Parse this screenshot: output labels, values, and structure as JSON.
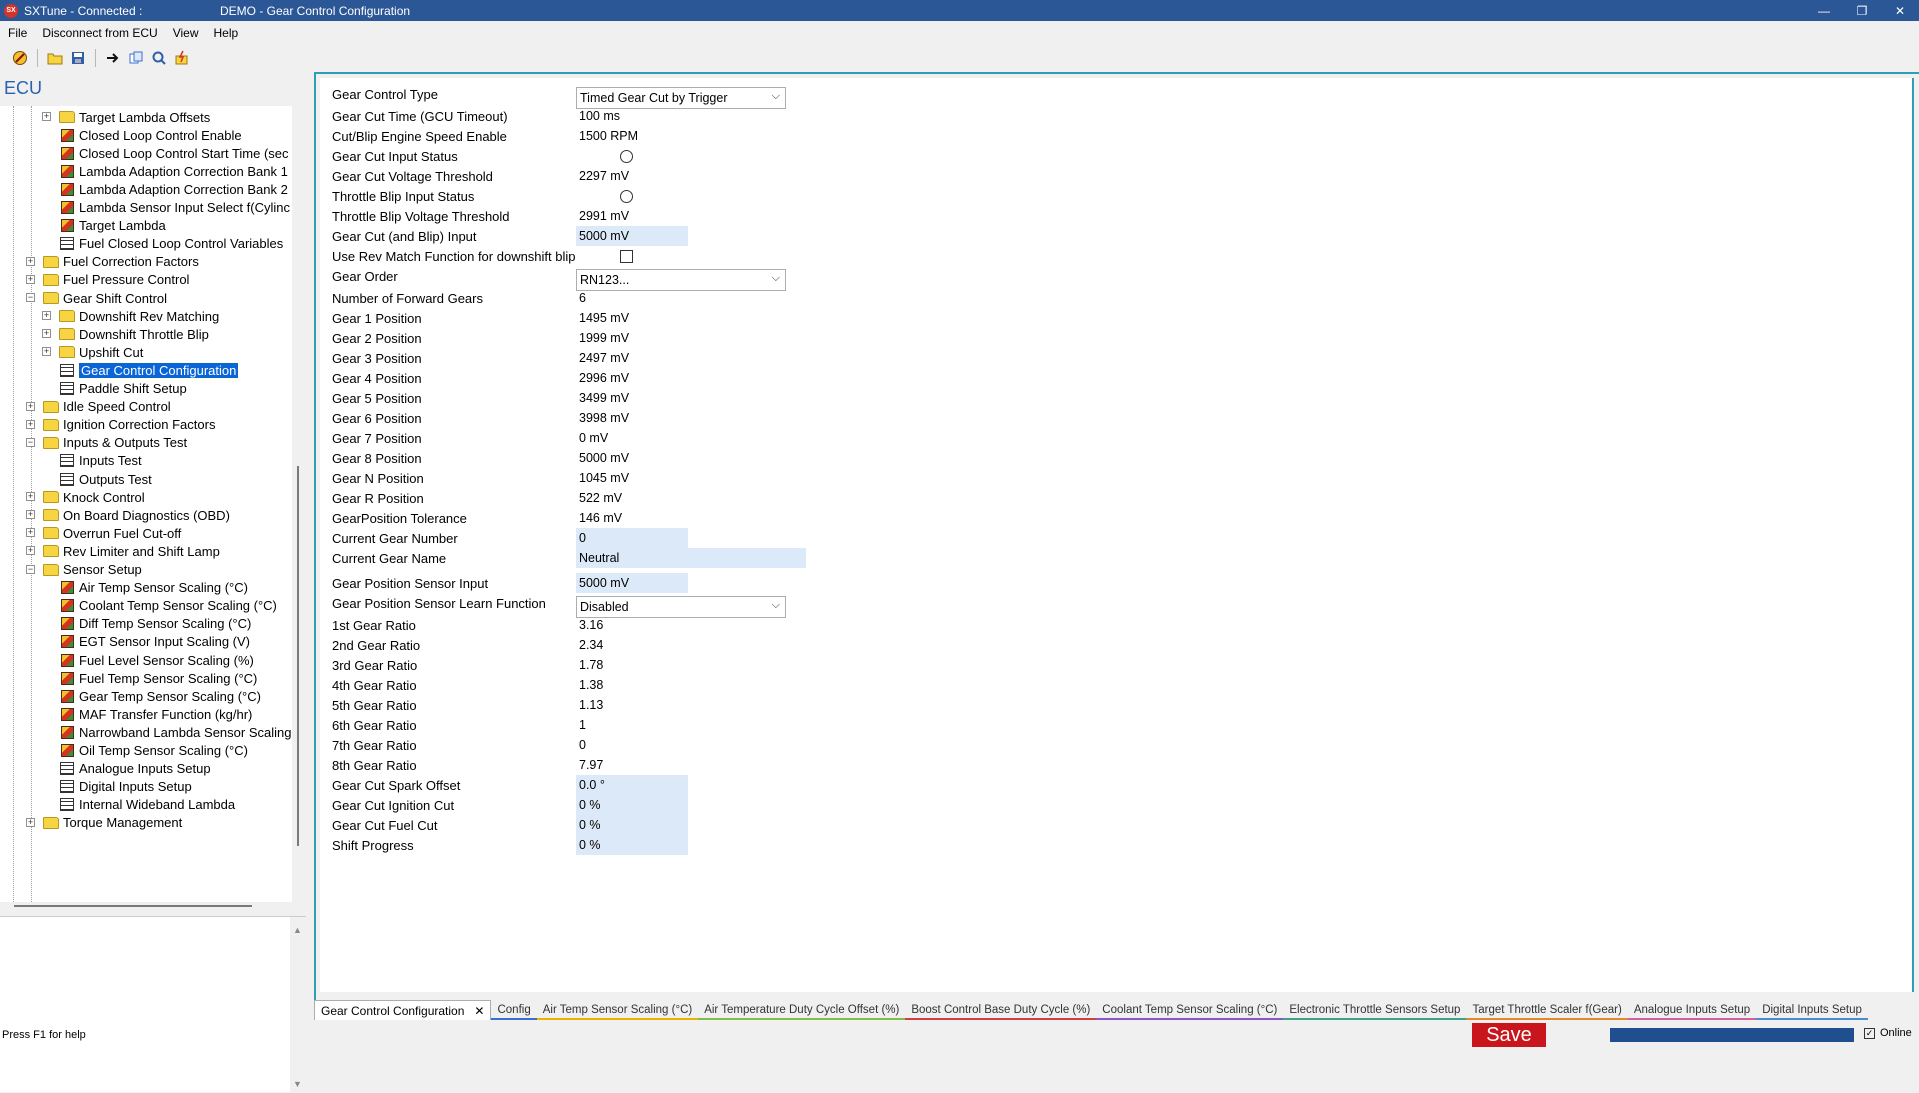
{
  "window": {
    "app_title": "SXTune - Connected :",
    "doc_title": "DEMO - Gear Control Configuration",
    "logo_text": "SX"
  },
  "menu": [
    "File",
    "Disconnect from ECU",
    "View",
    "Help"
  ],
  "toolbar": [
    "stop-icon",
    "open-folder-icon",
    "save-disk-icon",
    "navigate-icon",
    "copy-icon",
    "search-icon",
    "flash-icon"
  ],
  "ecu_label": "ECU",
  "tree": [
    {
      "label": "Target Lambda Offsets",
      "icon": "folder",
      "level": 2,
      "exp": "+"
    },
    {
      "label": "Closed Loop Control Enable",
      "icon": "cube",
      "level": 2
    },
    {
      "label": "Closed Loop Control Start Time (sec",
      "icon": "cube",
      "level": 2
    },
    {
      "label": "Lambda Adaption Correction Bank 1",
      "icon": "cube",
      "level": 2
    },
    {
      "label": "Lambda Adaption Correction Bank 2",
      "icon": "cube",
      "level": 2
    },
    {
      "label": "Lambda Sensor Input Select f(Cylinc",
      "icon": "cube",
      "level": 2
    },
    {
      "label": "Target Lambda",
      "icon": "cube",
      "level": 2
    },
    {
      "label": "Fuel Closed Loop Control Variables",
      "icon": "table",
      "level": 2
    },
    {
      "label": "Fuel Correction Factors",
      "icon": "folder",
      "level": 1,
      "exp": "+"
    },
    {
      "label": "Fuel Pressure Control",
      "icon": "folder",
      "level": 1,
      "exp": "+"
    },
    {
      "label": "Gear Shift Control",
      "icon": "folder",
      "level": 1,
      "exp": "-"
    },
    {
      "label": "Downshift Rev Matching",
      "icon": "folder",
      "level": 2,
      "exp": "+"
    },
    {
      "label": "Downshift Throttle Blip",
      "icon": "folder",
      "level": 2,
      "exp": "+"
    },
    {
      "label": "Upshift Cut",
      "icon": "folder",
      "level": 2,
      "exp": "+"
    },
    {
      "label": "Gear Control Configuration",
      "icon": "table",
      "level": 2,
      "selected": true
    },
    {
      "label": "Paddle Shift Setup",
      "icon": "table",
      "level": 2
    },
    {
      "label": "Idle Speed Control",
      "icon": "folder",
      "level": 1,
      "exp": "+"
    },
    {
      "label": "Ignition Correction Factors",
      "icon": "folder",
      "level": 1,
      "exp": "+"
    },
    {
      "label": "Inputs & Outputs Test",
      "icon": "folder",
      "level": 1,
      "exp": "-"
    },
    {
      "label": "Inputs Test",
      "icon": "table",
      "level": 2
    },
    {
      "label": "Outputs Test",
      "icon": "table",
      "level": 2
    },
    {
      "label": "Knock Control",
      "icon": "folder",
      "level": 1,
      "exp": "+"
    },
    {
      "label": "On Board Diagnostics (OBD)",
      "icon": "folder",
      "level": 1,
      "exp": "+"
    },
    {
      "label": "Overrun Fuel Cut-off",
      "icon": "folder",
      "level": 1,
      "exp": "+"
    },
    {
      "label": "Rev Limiter and Shift Lamp",
      "icon": "folder",
      "level": 1,
      "exp": "+"
    },
    {
      "label": "Sensor Setup",
      "icon": "folder",
      "level": 1,
      "exp": "-"
    },
    {
      "label": "Air Temp Sensor Scaling (°C)",
      "icon": "cube",
      "level": 2
    },
    {
      "label": "Coolant Temp Sensor Scaling (°C)",
      "icon": "cube",
      "level": 2
    },
    {
      "label": "Diff Temp Sensor Scaling (°C)",
      "icon": "cube",
      "level": 2
    },
    {
      "label": "EGT Sensor Input Scaling (V)",
      "icon": "cube",
      "level": 2
    },
    {
      "label": "Fuel Level Sensor Scaling (%)",
      "icon": "cube",
      "level": 2
    },
    {
      "label": "Fuel Temp Sensor Scaling (°C)",
      "icon": "cube",
      "level": 2
    },
    {
      "label": "Gear Temp Sensor Scaling (°C)",
      "icon": "cube",
      "level": 2
    },
    {
      "label": "MAF Transfer Function (kg/hr)",
      "icon": "cube",
      "level": 2
    },
    {
      "label": "Narrowband Lambda Sensor Scaling",
      "icon": "cube",
      "level": 2
    },
    {
      "label": "Oil Temp Sensor Scaling (°C)",
      "icon": "cube",
      "level": 2
    },
    {
      "label": "Analogue Inputs Setup",
      "icon": "table",
      "level": 2
    },
    {
      "label": "Digital Inputs Setup",
      "icon": "table",
      "level": 2
    },
    {
      "label": "Internal Wideband Lambda",
      "icon": "table",
      "level": 2
    },
    {
      "label": "Torque Management",
      "icon": "folder",
      "level": 1,
      "exp": "+"
    }
  ],
  "params": [
    {
      "label": "Gear Control Type",
      "type": "select",
      "value": "Timed Gear Cut by Trigger"
    },
    {
      "label": "Gear Cut Time (GCU Timeout)",
      "type": "edit",
      "value": "100 ms"
    },
    {
      "label": "Cut/Blip Engine Speed Enable",
      "type": "edit",
      "value": "1500 RPM"
    },
    {
      "label": "Gear Cut Input Status",
      "type": "radio",
      "value": ""
    },
    {
      "label": "Gear Cut Voltage Threshold",
      "type": "edit",
      "value": "2297 mV"
    },
    {
      "label": "Throttle Blip Input Status",
      "type": "radio",
      "value": ""
    },
    {
      "label": "Throttle Blip Voltage Threshold",
      "type": "edit",
      "value": "2991 mV"
    },
    {
      "label": "Gear Cut (and Blip) Input",
      "type": "ro",
      "value": "5000 mV"
    },
    {
      "label": "Use Rev Match Function for downshift blip",
      "type": "check",
      "value": ""
    },
    {
      "label": "Gear Order",
      "type": "select",
      "value": "RN123..."
    },
    {
      "label": "Number of Forward Gears",
      "type": "edit",
      "value": "6"
    },
    {
      "label": "Gear 1 Position",
      "type": "edit",
      "value": "1495 mV"
    },
    {
      "label": "Gear 2 Position",
      "type": "edit",
      "value": "1999 mV"
    },
    {
      "label": "Gear 3 Position",
      "type": "edit",
      "value": "2497 mV"
    },
    {
      "label": "Gear 4 Position",
      "type": "edit",
      "value": "2996 mV"
    },
    {
      "label": "Gear 5 Position",
      "type": "edit",
      "value": "3499 mV"
    },
    {
      "label": "Gear 6 Position",
      "type": "edit",
      "value": "3998 mV"
    },
    {
      "label": "Gear 7 Position",
      "type": "edit",
      "value": "0 mV"
    },
    {
      "label": "Gear 8 Position",
      "type": "edit",
      "value": "5000 mV"
    },
    {
      "label": "Gear N Position",
      "type": "edit",
      "value": "1045 mV"
    },
    {
      "label": "Gear R Position",
      "type": "edit",
      "value": "522 mV"
    },
    {
      "label": "GearPosition Tolerance",
      "type": "edit",
      "value": "146 mV"
    },
    {
      "label": "Current Gear Number",
      "type": "ro",
      "value": "0"
    },
    {
      "label": "Current Gear Name",
      "type": "ro-wide",
      "value": "Neutral"
    },
    {
      "label": "Gear Position Sensor Input",
      "type": "ro",
      "value": "5000 mV"
    },
    {
      "label": "Gear Position Sensor Learn Function",
      "type": "select",
      "value": "Disabled"
    },
    {
      "label": "1st Gear Ratio",
      "type": "edit",
      "value": "3.16"
    },
    {
      "label": "2nd Gear Ratio",
      "type": "edit",
      "value": "2.34"
    },
    {
      "label": "3rd Gear Ratio",
      "type": "edit",
      "value": "1.78"
    },
    {
      "label": "4th Gear Ratio",
      "type": "edit",
      "value": "1.38"
    },
    {
      "label": "5th Gear Ratio",
      "type": "edit",
      "value": "1.13"
    },
    {
      "label": "6th Gear Ratio",
      "type": "edit",
      "value": "1"
    },
    {
      "label": "7th Gear Ratio",
      "type": "edit",
      "value": "0"
    },
    {
      "label": "8th Gear Ratio",
      "type": "edit",
      "value": "7.97"
    },
    {
      "label": "Gear Cut Spark Offset",
      "type": "ro",
      "value": "0.0 °"
    },
    {
      "label": "Gear Cut Ignition Cut",
      "type": "ro",
      "value": "0 %"
    },
    {
      "label": "Gear Cut Fuel Cut",
      "type": "ro",
      "value": "0 %"
    },
    {
      "label": "Shift Progress",
      "type": "ro",
      "value": "0 %"
    }
  ],
  "tabs": [
    {
      "label": "Gear Control Configuration",
      "active": true,
      "color": "#2c9fb4"
    },
    {
      "label": "Config",
      "color": "#3a6fd0"
    },
    {
      "label": "Air Temp Sensor Scaling (°C)",
      "color": "#e8b400"
    },
    {
      "label": "Air Temperature Duty Cycle Offset (%)",
      "color": "#7cc04a"
    },
    {
      "label": "Boost Control Base Duty Cycle (%)",
      "color": "#d04040"
    },
    {
      "label": "Coolant Temp Sensor Scaling (°C)",
      "color": "#8a56c8"
    },
    {
      "label": "Electronic Throttle Sensors Setup",
      "color": "#3aa38a"
    },
    {
      "label": "Target Throttle Scaler f(Gear)",
      "color": "#e08a2a"
    },
    {
      "label": "Analogue Inputs Setup",
      "color": "#d060a0"
    },
    {
      "label": "Digital Inputs Setup",
      "color": "#4a8ad0"
    }
  ],
  "status": {
    "help": "Press F1 for help",
    "save_label": "Save",
    "online_label": "Online",
    "online_checked": true
  }
}
